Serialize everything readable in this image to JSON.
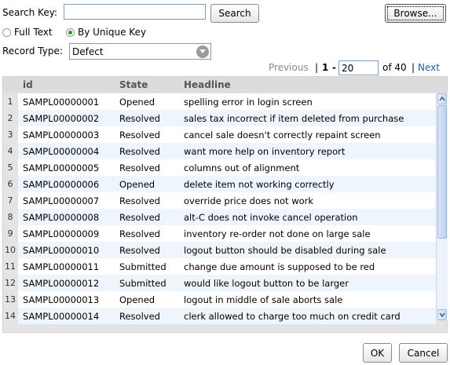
{
  "search": {
    "label": "Search Key:",
    "value": "",
    "button": "Search",
    "browse": "Browse..."
  },
  "mode": {
    "full_text": "Full Text",
    "unique_key": "By Unique Key",
    "selected": "unique_key"
  },
  "record_type": {
    "label": "Record Type:",
    "value": "Defect"
  },
  "paging": {
    "previous": "Previous",
    "separator": "|",
    "start": "1",
    "dash": "-",
    "end": "20",
    "of_total": "of 40",
    "pipe": "|",
    "next": "Next"
  },
  "grid": {
    "columns": [
      "id",
      "State",
      "Headline"
    ],
    "rows": [
      {
        "num": "1",
        "id": "SAMPL00000001",
        "state": "Opened",
        "headline": "spelling error in login screen"
      },
      {
        "num": "2",
        "id": "SAMPL00000002",
        "state": "Resolved",
        "headline": "sales tax incorrect if item deleted from purchase"
      },
      {
        "num": "3",
        "id": "SAMPL00000003",
        "state": "Resolved",
        "headline": "cancel sale doesn't correctly repaint screen"
      },
      {
        "num": "4",
        "id": "SAMPL00000004",
        "state": "Resolved",
        "headline": "want more help on inventory report"
      },
      {
        "num": "5",
        "id": "SAMPL00000005",
        "state": "Resolved",
        "headline": "columns out of alignment"
      },
      {
        "num": "6",
        "id": "SAMPL00000006",
        "state": "Opened",
        "headline": "delete item not working correctly"
      },
      {
        "num": "7",
        "id": "SAMPL00000007",
        "state": "Resolved",
        "headline": "override price does not work"
      },
      {
        "num": "8",
        "id": "SAMPL00000008",
        "state": "Resolved",
        "headline": "alt-C does not invoke cancel operation"
      },
      {
        "num": "9",
        "id": "SAMPL00000009",
        "state": "Resolved",
        "headline": "inventory re-order not done on large sale"
      },
      {
        "num": "10",
        "id": "SAMPL00000010",
        "state": "Resolved",
        "headline": "logout button should be disabled during sale"
      },
      {
        "num": "11",
        "id": "SAMPL00000011",
        "state": "Submitted",
        "headline": "change due amount is supposed to be red"
      },
      {
        "num": "12",
        "id": "SAMPL00000012",
        "state": "Submitted",
        "headline": "would like logout button to be larger"
      },
      {
        "num": "13",
        "id": "SAMPL00000013",
        "state": "Opened",
        "headline": "logout in middle of sale aborts sale"
      },
      {
        "num": "14",
        "id": "SAMPL00000014",
        "state": "Resolved",
        "headline": "clerk allowed to charge too much on credit card"
      }
    ]
  },
  "footer": {
    "ok": "OK",
    "cancel": "Cancel"
  },
  "colors": {
    "link": "#1a5fb4",
    "radio_checked": "#2a9a2a"
  },
  "icons": {
    "dropdown": "chevron-down-icon",
    "scroll_up": "arrow-up-icon",
    "scroll_down": "arrow-down-icon"
  }
}
